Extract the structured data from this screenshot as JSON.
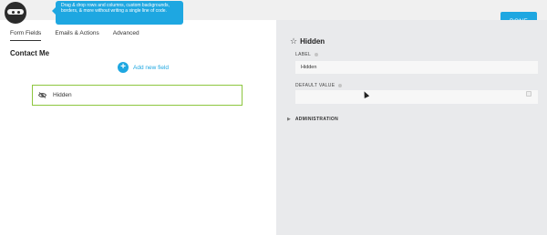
{
  "tooltip": {
    "text": "Drag & drop rows and columns, custom backgrounds, borders, & more without writing a single line of code."
  },
  "toolbar": {
    "done_label": "DONE"
  },
  "tabs": [
    {
      "label": "Form Fields"
    },
    {
      "label": "Emails & Actions"
    },
    {
      "label": "Advanced"
    }
  ],
  "form": {
    "title": "Contact Me",
    "add_field_label": "Add new field",
    "fields": [
      {
        "label": "Hidden",
        "icon": "eye-slash-icon"
      }
    ]
  },
  "settings": {
    "title": "Hidden",
    "label_caption": "LABEL",
    "label_value": "Hidden",
    "default_caption": "DEFAULT VALUE",
    "default_value": "",
    "admin_caption": "ADMINISTRATION"
  },
  "colors": {
    "accent": "#1ea7e1",
    "selected_border": "#8dc63f",
    "panel_bg": "#e9eaec"
  }
}
